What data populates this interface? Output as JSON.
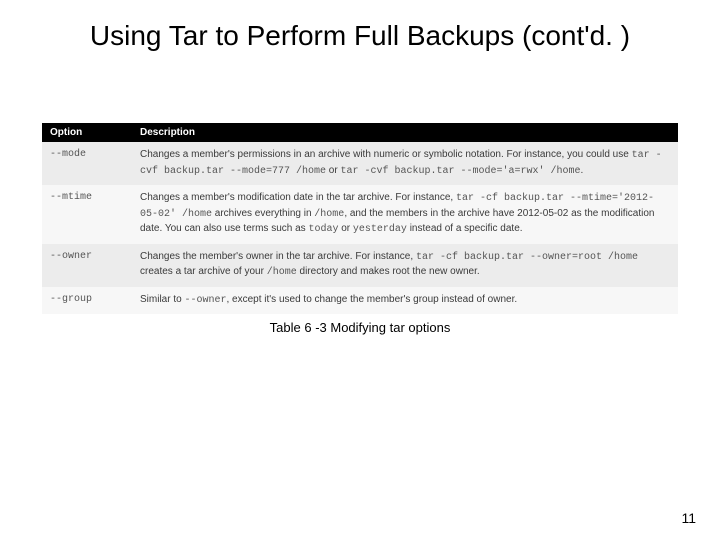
{
  "title": "Using Tar to Perform Full Backups (cont'd. )",
  "headers": {
    "option": "Option",
    "description": "Description"
  },
  "rows": [
    {
      "option": "--mode",
      "d1": "Changes a member's permissions in an archive with numeric or symbolic notation. For instance, you could use ",
      "c1": "tar -cvf backup.tar --mode=777 /home",
      "d2": " or ",
      "c2": "tar -cvf backup.tar --mode='a=rwx' /home",
      "d3": "."
    },
    {
      "option": "--mtime",
      "d1": "Changes a member's modification date in the tar archive. For instance, ",
      "c1": "tar -cf backup.tar --mtime='2012-05-02' /home",
      "d2": " archives everything in ",
      "c2": "/home",
      "d3": ", and the members in the archive have 2012-05-02 as the modification date. You can also use terms such as ",
      "c3": "today",
      "d4": " or ",
      "c4": "yesterday",
      "d5": " instead of a specific date."
    },
    {
      "option": "--owner",
      "d1": "Changes the member's owner in the tar archive. For instance, ",
      "c1": "tar -cf backup.tar --owner=root /home",
      "d2": " creates a tar archive of your ",
      "c2": "/home",
      "d3": " directory and makes root the new owner."
    },
    {
      "option": "--group",
      "d1": "Similar to ",
      "c1": "--owner",
      "d2": ", except it's used to change the member's group instead of owner."
    }
  ],
  "caption": "Table 6 -3 Modifying tar options",
  "page": "11"
}
